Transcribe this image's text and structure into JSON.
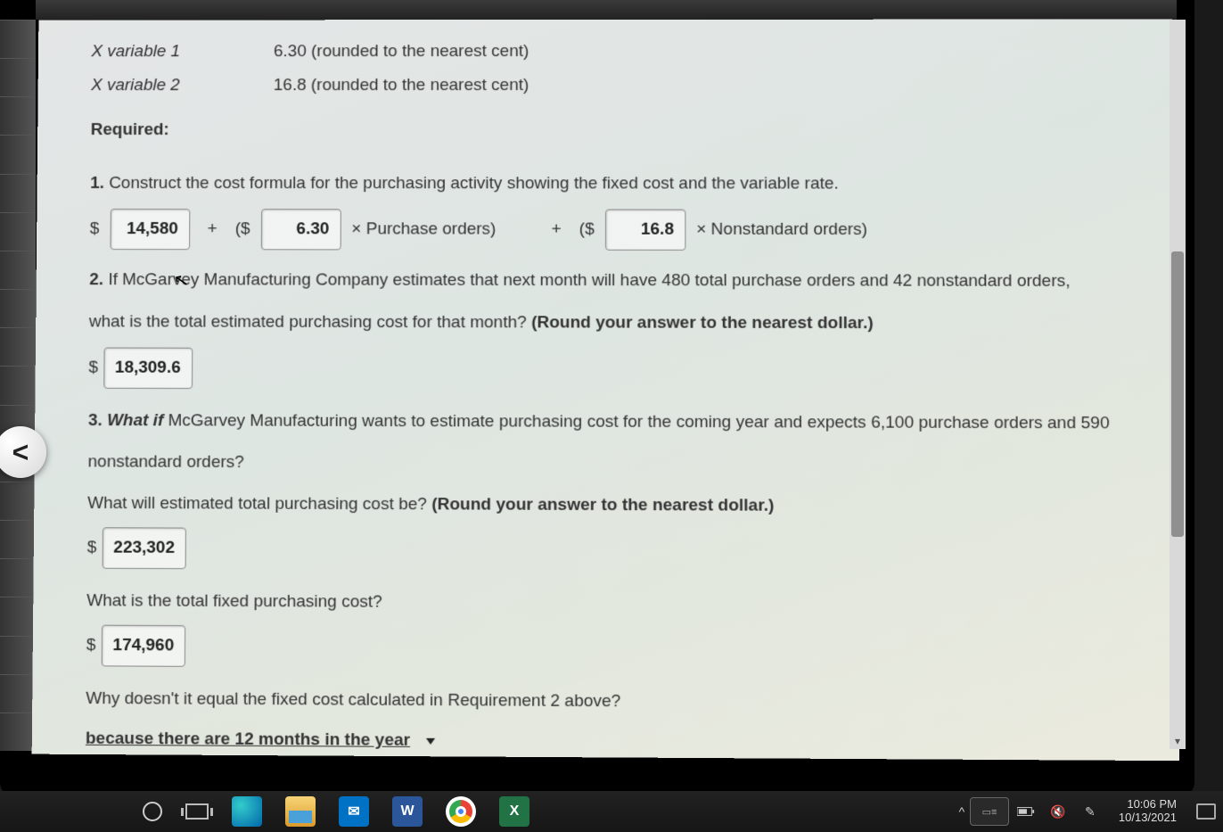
{
  "xvars": [
    {
      "label": "X variable 1",
      "value": "6.30 (rounded to the nearest cent)"
    },
    {
      "label": "X variable 2",
      "value": "16.8 (rounded to the nearest cent)"
    }
  ],
  "required_label": "Required:",
  "q1": {
    "num": "1.",
    "text": "Construct the cost formula for the purchasing activity showing the fixed cost and the variable rate.",
    "fixed": "14,580",
    "rate1": "6.30",
    "mult1": "× Purchase orders)",
    "rate2": "16.8",
    "mult2": "× Nonstandard orders)",
    "plus": "+",
    "open": "($"
  },
  "q2": {
    "num": "2.",
    "text_a": "If McGarvey Manufacturing Company estimates that next month will have 480 total purchase orders and 42 nonstandard orders,",
    "text_b": "what is the total estimated purchasing cost for that month? ",
    "round": "(Round your answer to the nearest dollar.)",
    "answer": "18,309.6"
  },
  "q3": {
    "num": "3.",
    "whatif": "What if",
    "text_a": " McGarvey Manufacturing wants to estimate purchasing cost for the coming year and expects 6,100 purchase orders and 590",
    "text_b": "nonstandard orders?",
    "sub1_q": "What will estimated total purchasing cost be? ",
    "sub1_round": "(Round your answer to the nearest dollar.)",
    "sub1_ans": "223,302",
    "sub2_q": "What is the total fixed purchasing cost?",
    "sub2_ans": "174,960",
    "sub3_q": "Why doesn't it equal the fixed cost calculated in Requirement 2 above?",
    "sub3_sel": "because there are 12 months in the year"
  },
  "dollar": "$",
  "taskbar": {
    "word": "W",
    "excel": "X",
    "time": "10:06 PM",
    "date": "10/13/2021",
    "chevron": "^"
  }
}
